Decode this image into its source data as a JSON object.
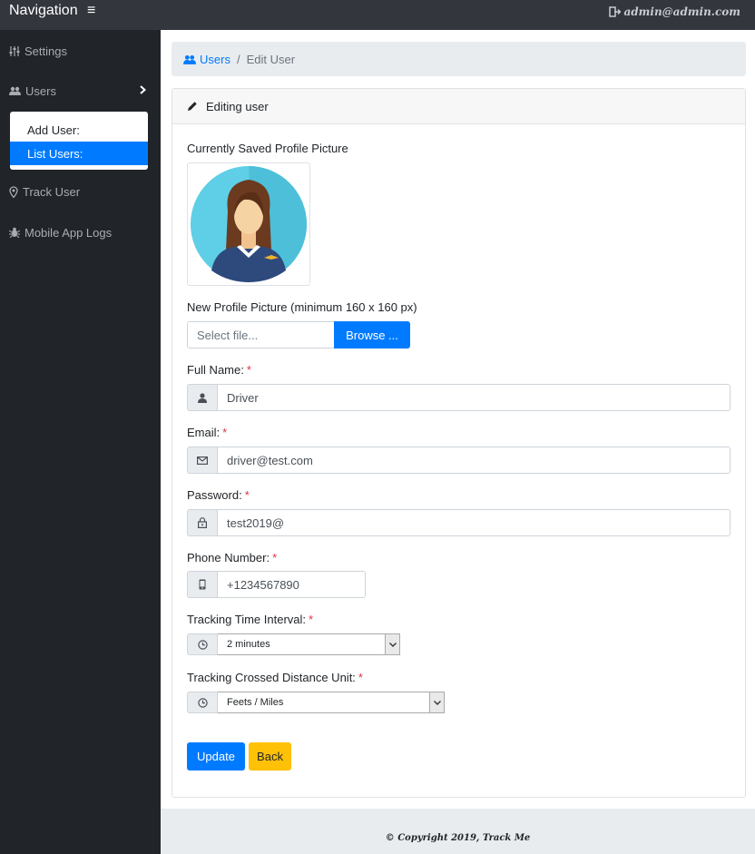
{
  "topbar": {
    "brand": "Navigation",
    "user": "admin@admin.com"
  },
  "sidebar": {
    "items": [
      {
        "label": "Settings",
        "icon": "sliders-icon"
      },
      {
        "label": "Users",
        "icon": "users-icon"
      },
      {
        "label": "Track User",
        "icon": "map-pin-icon"
      },
      {
        "label": "Mobile App Logs",
        "icon": "bug-icon"
      }
    ],
    "submenu": [
      {
        "label": "Add User:",
        "active": false
      },
      {
        "label": "List Users:",
        "active": true
      }
    ]
  },
  "breadcrumb": {
    "root": "Users",
    "current": "Edit User",
    "separator": "/"
  },
  "card": {
    "title": "Editing user"
  },
  "form": {
    "current_picture_label": "Currently Saved Profile Picture",
    "new_picture_label": "New Profile Picture (minimum 160 x 160 px)",
    "file_placeholder": "Select file...",
    "browse_label": "Browse ...",
    "required_mark": "*",
    "full_name": {
      "label": "Full Name:",
      "value": "Driver"
    },
    "email": {
      "label": "Email:",
      "value": "driver@test.com"
    },
    "password": {
      "label": "Password:",
      "value": "test2019@"
    },
    "phone": {
      "label": "Phone Number:",
      "value": "+1234567890"
    },
    "interval": {
      "label": "Tracking Time Interval:",
      "value": "2 minutes"
    },
    "distance_unit": {
      "label": "Tracking Crossed Distance Unit:",
      "value": "Feets / Miles"
    },
    "update_label": "Update",
    "back_label": "Back"
  },
  "footer": {
    "text": "© Copyright 2019, Track Me"
  },
  "colors": {
    "primary": "#007bff",
    "warning": "#ffc107",
    "sidebar": "#212529",
    "topbar": "#33363d",
    "danger": "#dc3545"
  }
}
